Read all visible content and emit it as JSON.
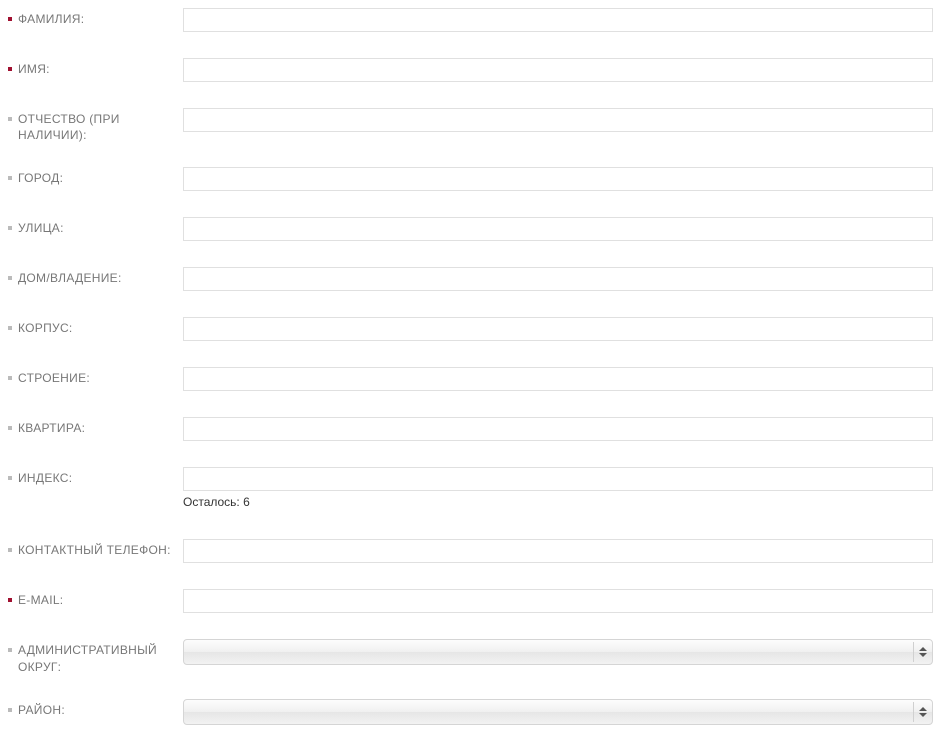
{
  "fields": {
    "surname": {
      "label": "ФАМИЛИЯ:",
      "required": true,
      "value": ""
    },
    "firstname": {
      "label": "ИМЯ:",
      "required": true,
      "value": ""
    },
    "patronymic": {
      "label": "ОТЧЕСТВО (ПРИ НАЛИЧИИ):",
      "required": false,
      "value": ""
    },
    "city": {
      "label": "ГОРОД:",
      "required": false,
      "value": ""
    },
    "street": {
      "label": "УЛИЦА:",
      "required": false,
      "value": ""
    },
    "house": {
      "label": "ДОМ/ВЛАДЕНИЕ:",
      "required": false,
      "value": ""
    },
    "building": {
      "label": "КОРПУС:",
      "required": false,
      "value": ""
    },
    "structure": {
      "label": "СТРОЕНИЕ:",
      "required": false,
      "value": ""
    },
    "apartment": {
      "label": "КВАРТИРА:",
      "required": false,
      "value": ""
    },
    "postal": {
      "label": "ИНДЕКС:",
      "required": false,
      "value": "",
      "helper": "Осталось: 6"
    },
    "phone": {
      "label": "КОНТАКТНЫЙ ТЕЛЕФОН:",
      "required": false,
      "value": ""
    },
    "email": {
      "label": "E-MAIL:",
      "required": true,
      "value": ""
    },
    "district": {
      "label": "АДМИНИСТРАТИВНЫЙ ОКРУГ:",
      "required": false,
      "selected": ""
    },
    "region": {
      "label": "РАЙОН:",
      "required": false,
      "selected": ""
    }
  }
}
